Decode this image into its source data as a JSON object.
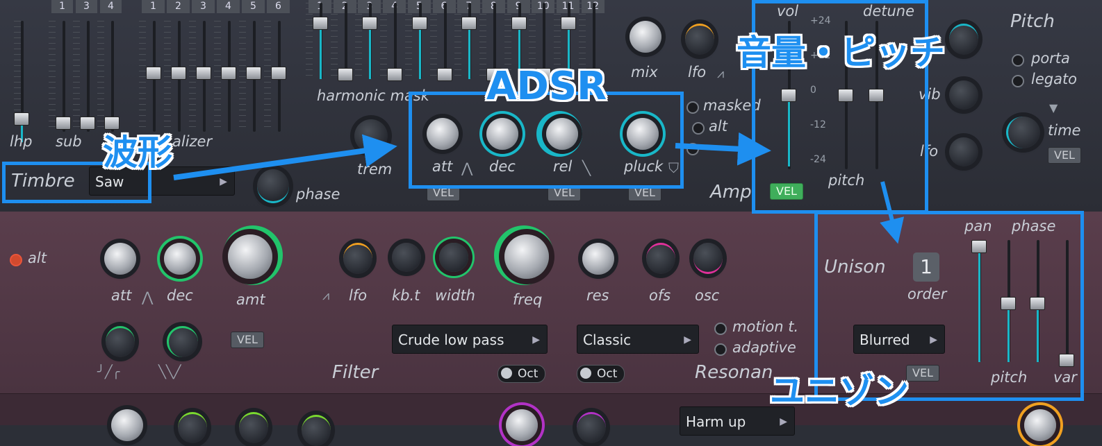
{
  "harmonics": {
    "sub_header": [
      "1",
      "3",
      "4"
    ],
    "equalizer_header": [
      "1",
      "2",
      "3",
      "4",
      "5",
      "6"
    ],
    "mask_header": [
      "1",
      "2",
      "3",
      "4",
      "5",
      "6",
      "7",
      "8",
      "9",
      "10",
      "11",
      "12"
    ],
    "lhp_label": "lhp",
    "sub_label": "sub",
    "equalizer_label": "alizer",
    "mask_label": "harmonic mask",
    "mix_label": "mix",
    "lfo_label": "lfo"
  },
  "timbre": {
    "label": "Timbre",
    "waveform": "Saw",
    "trem_label": "trem",
    "phase_label": "phase"
  },
  "amp": {
    "att_label": "att",
    "dec_label": "dec",
    "rel_label": "rel",
    "pluck_label": "pluck",
    "vel_label": "VEL",
    "masked_label": "masked",
    "alt_label": "alt",
    "amp_label": "Amp"
  },
  "volpitch": {
    "vol_label": "vol",
    "detune_label": "detune",
    "scale": [
      "+24",
      "+12",
      "0",
      "-12",
      "-24"
    ],
    "pitch_label": "pitch",
    "vel_label": "VEL"
  },
  "pitch_section": {
    "title": "Pitch",
    "porta_label": "porta",
    "legato_label": "legato",
    "vib_label": "vib",
    "lfo_label": "lfo",
    "time_label": "time",
    "vel_label": "VEL"
  },
  "filter": {
    "alt_label": "alt",
    "att_label": "att",
    "dec_label": "dec",
    "amt_label": "amt",
    "lfo_label": "lfo",
    "kbt_label": "kb.t",
    "width_label": "width",
    "freq_label": "freq",
    "res_label": "res",
    "ofs_label": "ofs",
    "osc_label": "osc",
    "vel_label": "VEL",
    "type": "Crude low pass",
    "mode": "Classic",
    "oct_label": "Oct",
    "motion_label": "motion t.",
    "adaptive_label": "adaptive",
    "filter_label": "Filter",
    "resonance_label": "Resonan"
  },
  "unison": {
    "title": "Unison",
    "order_value": "1",
    "order_label": "order",
    "pan_label": "pan",
    "phase_label": "phase",
    "pitch_label": "pitch",
    "var_label": "var",
    "mode": "Blurred",
    "vel_label": "VEL"
  },
  "bottom": {
    "dropdown": "Harm up"
  },
  "annotations": {
    "waveform": "波形",
    "adsr": "ADSR",
    "volume_pitch": "音量・ピッチ",
    "unison": "ユニゾン"
  },
  "colors": {
    "annotation": "#1e8ff0",
    "accent_cyan": "#19b7c8",
    "accent_green": "#22c46b",
    "accent_orange": "#f0a020",
    "accent_magenta": "#e0309a"
  }
}
